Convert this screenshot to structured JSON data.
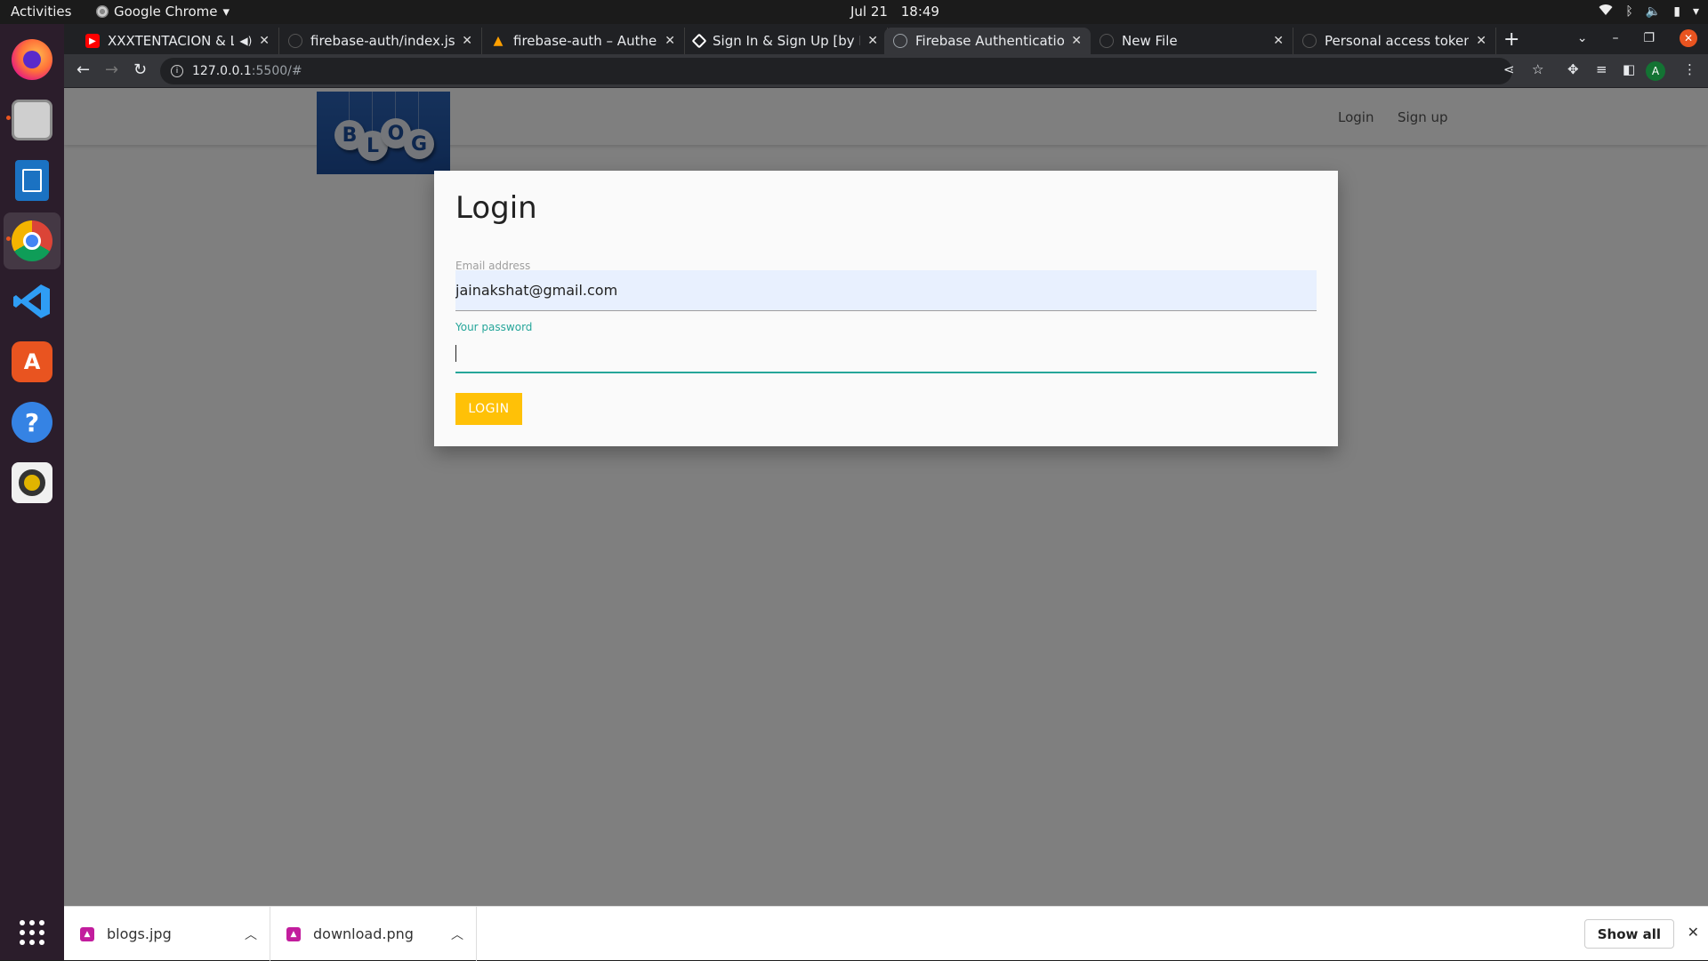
{
  "topbar": {
    "activities": "Activities",
    "app_name": "Google Chrome",
    "date": "Jul 21",
    "time": "18:49"
  },
  "dock": {
    "items": [
      "firefox-icon",
      "files-icon",
      "libreoffice-writer-icon",
      "chrome-icon",
      "vscode-icon",
      "app-center-icon",
      "help-icon",
      "rhythmbox-icon",
      "show-apps-icon"
    ]
  },
  "tabs": [
    {
      "title": "XXXTENTACION & Li",
      "favicon": "youtube-icon",
      "favicon_color": "#ff0000"
    },
    {
      "title": "firebase-auth/index.js a",
      "favicon": "github-icon",
      "favicon_color": "#202124"
    },
    {
      "title": "firebase-auth – Authent",
      "favicon": "firebase-icon",
      "favicon_color": "#ffa000"
    },
    {
      "title": "Sign In & Sign Up [by Bo",
      "favicon": "codepen-icon",
      "favicon_color": "#ffffff"
    },
    {
      "title": "Firebase Authentication",
      "favicon": "globe-icon",
      "favicon_color": "#9aa0a6"
    },
    {
      "title": "New File",
      "favicon": "github-icon",
      "favicon_color": "#202124"
    },
    {
      "title": "Personal access tokens",
      "favicon": "github-icon",
      "favicon_color": "#202124"
    }
  ],
  "omnibox": {
    "host": "127.0.0.1",
    "path": ":5500/#"
  },
  "profile_initial": "A",
  "site": {
    "logo_letters": [
      "B",
      "L",
      "O",
      "G"
    ],
    "nav_login": "Login",
    "nav_signup": "Sign up"
  },
  "modal": {
    "title": "Login",
    "email_label": "Email address",
    "email_value": "jainakshat@gmail.com",
    "password_label": "Your password",
    "password_value": "",
    "button_label": "LOGIN"
  },
  "downloads": {
    "items": [
      {
        "filename": "blogs.jpg"
      },
      {
        "filename": "download.png"
      }
    ],
    "show_all": "Show all"
  },
  "colors": {
    "accent_teal": "#26a69a",
    "button_amber": "#ffc107",
    "autofill_blue": "#e8f0fe",
    "ubuntu_orange": "#e95420"
  }
}
